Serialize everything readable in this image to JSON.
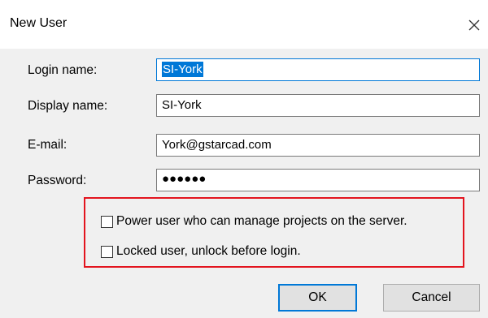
{
  "window": {
    "title": "New User",
    "close_icon": "close-icon"
  },
  "form": {
    "login_name": {
      "label": "Login name:",
      "value": "SI-York"
    },
    "display_name": {
      "label": "Display name:",
      "value": "SI-York"
    },
    "email": {
      "label": "E-mail:",
      "value": "York@gstarcad.com"
    },
    "password": {
      "label": "Password:",
      "value": "●●●●●●"
    }
  },
  "options": {
    "power_user": {
      "label": "Power user who can manage projects on the server.",
      "checked": false
    },
    "locked_user": {
      "label": "Locked user, unlock before login.",
      "checked": false
    }
  },
  "buttons": {
    "ok": "OK",
    "cancel": "Cancel"
  },
  "colors": {
    "highlight_border": "#e3141e",
    "focus_accent": "#0078d7",
    "dialog_background": "#f0f0f0"
  }
}
